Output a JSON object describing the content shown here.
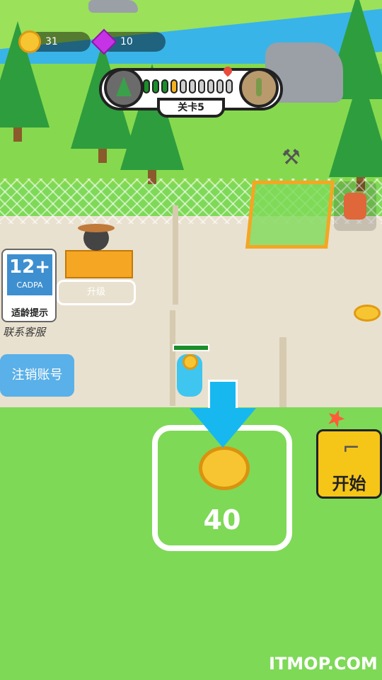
{
  "hud": {
    "coins": "31",
    "gems": "10",
    "coin_icon": "gold-coin-icon",
    "gem_icon": "purple-gem-icon"
  },
  "level": {
    "label": "关卡5",
    "segments_total": 10,
    "current_segment": 4,
    "start_icon": "tree-stage-icon",
    "end_icon": "desert-stage-icon"
  },
  "left_panel": {
    "age_rating": "12+",
    "rating_org": "CADPA",
    "rating_hint": "适龄提示",
    "contact_service": "联系客服",
    "cancel_account": "注销账号"
  },
  "upgrade_pad": {
    "label": "升级"
  },
  "drop_zone": {
    "cost": "40"
  },
  "start_button": {
    "label": "开始",
    "icon": "pistol-icon"
  },
  "watermark": {
    "text": "ITMOP.COM"
  },
  "colors": {
    "accent_yellow": "#f5c518",
    "grass": "#7ed957",
    "river": "#39b4e8",
    "blue_button": "#5ab0e8"
  }
}
